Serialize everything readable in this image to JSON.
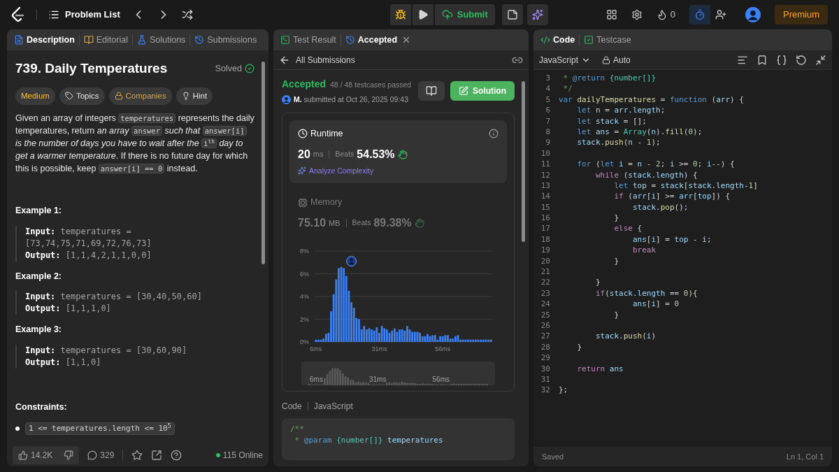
{
  "topbar": {
    "title": "Problem List",
    "submit": "Submit",
    "streak": "0",
    "premium": "Premium"
  },
  "left": {
    "tabs": [
      {
        "label": "Description",
        "selected": true
      },
      {
        "label": "Editorial",
        "selected": false
      },
      {
        "label": "Solutions",
        "selected": false
      },
      {
        "label": "Submissions",
        "selected": false
      }
    ],
    "title": "739. Daily Temperatures",
    "status": "Solved",
    "tags": [
      {
        "kind": "difficulty",
        "label": "Medium"
      },
      {
        "kind": "topics",
        "label": "Topics"
      },
      {
        "kind": "companies",
        "label": "Companies"
      },
      {
        "kind": "hint",
        "label": "Hint"
      }
    ],
    "description": [
      {
        "kind": "text",
        "text": "Given an array of integers "
      },
      {
        "kind": "code",
        "text": "temperatures"
      },
      {
        "kind": "text",
        "text": " represents the daily temperatures, return "
      },
      {
        "kind": "em",
        "text": "an array "
      },
      {
        "kind": "code",
        "text": "answer"
      },
      {
        "kind": "em",
        "text": " such that "
      },
      {
        "kind": "code",
        "text": "answer[i]"
      },
      {
        "kind": "em",
        "text": " is the number of days you have to wait after the "
      },
      {
        "kind": "code",
        "text": "i$^{th}$"
      },
      {
        "kind": "em",
        "text": " day to get a warmer temperature"
      },
      {
        "kind": "text",
        "text": ". If there is no future day for which this is possible, keep "
      },
      {
        "kind": "code",
        "text": "answer[i] == 0"
      },
      {
        "kind": "text",
        "text": " instead."
      }
    ],
    "examples": [
      {
        "title": "Example 1:",
        "input_label": "Input:",
        "input": "temperatures = [73,74,75,71,69,72,76,73]",
        "output_label": "Output:",
        "output": "[1,1,4,2,1,1,0,0]"
      },
      {
        "title": "Example 2:",
        "input_label": "Input:",
        "input": "temperatures = [30,40,50,60]",
        "output_label": "Output:",
        "output": "[1,1,1,0]"
      },
      {
        "title": "Example 3:",
        "input_label": "Input:",
        "input": "temperatures = [30,60,90]",
        "output_label": "Output:",
        "output": "[1,1,0]"
      }
    ],
    "constraints_title": "Constraints:",
    "constraints": [
      "1 <= temperatures.length <= 10$^{5}$"
    ],
    "footer": {
      "likes": "14.2K",
      "comments": "329",
      "online": "115 Online"
    }
  },
  "middle": {
    "tabs": [
      {
        "label": "Test Result",
        "selected": false,
        "closable": false
      },
      {
        "label": "Accepted",
        "selected": true,
        "closable": true
      }
    ],
    "back": "All Submissions",
    "status": "Accepted",
    "passed": "48 / 48 testcases passed",
    "user": "M.",
    "submitted": "submitted at Oct 26, 2025 09:43",
    "solution": "Solution",
    "metrics": [
      {
        "kind": "runtime",
        "title": "Runtime",
        "value": "20",
        "unit": "ms",
        "beats_label": "Beats",
        "beats": "54.53%",
        "action": "Analyze Complexity",
        "selected": true
      },
      {
        "kind": "memory",
        "title": "Memory",
        "value": "75.10",
        "unit": "MB",
        "beats_label": "Beats",
        "beats": "89.38%",
        "selected": false
      }
    ],
    "chart_data": {
      "type": "bar",
      "x": [
        6,
        7,
        8,
        9,
        10,
        11,
        12,
        13,
        14,
        15,
        16,
        17,
        18,
        19,
        20,
        21,
        22,
        23,
        24,
        25,
        26,
        27,
        28,
        29,
        30,
        31,
        32,
        33,
        34,
        35,
        36,
        37,
        38,
        39,
        40,
        41,
        42,
        43,
        44,
        45,
        46,
        47,
        48,
        49,
        50,
        51,
        52,
        53,
        54,
        55,
        56,
        57,
        58,
        59,
        60,
        61,
        62,
        63,
        64,
        65,
        66,
        67,
        68,
        69,
        70,
        71,
        72,
        73,
        74,
        75
      ],
      "values": [
        0.2,
        0.2,
        0.2,
        0.3,
        0.7,
        0.8,
        2.7,
        4.2,
        5.5,
        6.5,
        6.6,
        6.5,
        5.8,
        4.5,
        3.5,
        3.0,
        2.1,
        2.0,
        1.1,
        1.4,
        1.1,
        1.2,
        1.1,
        1.0,
        1.3,
        0.8,
        1.4,
        1.2,
        1.1,
        0.8,
        1.0,
        1.2,
        0.9,
        1.1,
        1.1,
        1.0,
        1.4,
        1.1,
        0.9,
        0.9,
        0.9,
        0.8,
        0.5,
        0.5,
        0.7,
        0.5,
        0.6,
        0.6,
        0.2,
        0.5,
        0.5,
        0.6,
        0.6,
        0.3,
        0.3,
        0.5,
        0.6,
        0.2,
        0.2,
        0.2,
        0.2,
        0.2,
        0.2,
        0.2,
        0.2,
        0.2,
        0.2,
        0.2,
        0.2,
        0.2
      ],
      "xlim": [
        5.5,
        75.5
      ],
      "ylim": [
        0,
        8
      ],
      "grid": true,
      "yticks": [
        {
          "value": 0,
          "label": "0%"
        },
        {
          "value": 2,
          "label": "2%"
        },
        {
          "value": 4,
          "label": "4%"
        },
        {
          "value": 6,
          "label": "6%"
        },
        {
          "value": 8,
          "label": "8%"
        }
      ],
      "xticks": [
        {
          "value": 6,
          "label": "6ms"
        },
        {
          "value": 31,
          "label": "31ms"
        },
        {
          "value": 56,
          "label": "56ms"
        }
      ]
    },
    "overview_labels": [
      "6ms",
      "31ms",
      "56ms"
    ],
    "code_label": "Code",
    "language": "JavaScript",
    "code": [
      [
        {
          "kind": "cm",
          "text": "/**"
        }
      ],
      [
        {
          "kind": "cm",
          "text": " *"
        },
        {
          "kind": "tag",
          "text": " @param"
        },
        {
          "kind": "type",
          "text": " {number[]}"
        },
        {
          "kind": "id",
          "text": " temperatures"
        }
      ]
    ]
  },
  "right": {
    "tabs": [
      {
        "label": "Code",
        "selected": true
      },
      {
        "label": "Testcase",
        "selected": false
      }
    ],
    "language": "JavaScript",
    "mode": "Auto",
    "lines": [
      {
        "n": "3",
        "t": [
          {
            "kind": "cm",
            "text": " *"
          },
          {
            "kind": "tag",
            "text": " @return"
          },
          {
            "kind": "type",
            "text": " {number[]}"
          }
        ]
      },
      {
        "n": "4",
        "t": [
          {
            "kind": "cm",
            "text": " */"
          }
        ]
      },
      {
        "n": "5",
        "t": [
          {
            "kind": "kw",
            "text": "var"
          },
          {
            "kind": "fn",
            "text": " dailyTemperatures"
          },
          {
            "kind": "p",
            "text": " = "
          },
          {
            "kind": "kw",
            "text": "function"
          },
          {
            "kind": "p",
            "text": " ("
          },
          {
            "kind": "id",
            "text": "arr"
          },
          {
            "kind": "p",
            "text": ") {"
          }
        ]
      },
      {
        "n": "6",
        "t": [
          {
            "kind": "kw",
            "text": "    let"
          },
          {
            "kind": "id",
            "text": " n"
          },
          {
            "kind": "p",
            "text": " = "
          },
          {
            "kind": "id",
            "text": "arr"
          },
          {
            "kind": "p",
            "text": "."
          },
          {
            "kind": "id",
            "text": "length"
          },
          {
            "kind": "p",
            "text": ";"
          }
        ]
      },
      {
        "n": "7",
        "t": [
          {
            "kind": "kw",
            "text": "    let"
          },
          {
            "kind": "id",
            "text": " stack"
          },
          {
            "kind": "p",
            "text": " = [];"
          }
        ]
      },
      {
        "n": "8",
        "t": [
          {
            "kind": "kw",
            "text": "    let"
          },
          {
            "kind": "id",
            "text": " ans"
          },
          {
            "kind": "p",
            "text": " = "
          },
          {
            "kind": "cls",
            "text": "Array"
          },
          {
            "kind": "p",
            "text": "("
          },
          {
            "kind": "id",
            "text": "n"
          },
          {
            "kind": "p",
            "text": ")."
          },
          {
            "kind": "fn",
            "text": "fill"
          },
          {
            "kind": "p",
            "text": "("
          },
          {
            "kind": "num",
            "text": "0"
          },
          {
            "kind": "p",
            "text": ");"
          }
        ]
      },
      {
        "n": "9",
        "t": [
          {
            "kind": "id",
            "text": "    stack"
          },
          {
            "kind": "p",
            "text": "."
          },
          {
            "kind": "fn",
            "text": "push"
          },
          {
            "kind": "p",
            "text": "("
          },
          {
            "kind": "id",
            "text": "n"
          },
          {
            "kind": "p",
            "text": " - "
          },
          {
            "kind": "num",
            "text": "1"
          },
          {
            "kind": "p",
            "text": ");"
          }
        ]
      },
      {
        "n": "10"
      },
      {
        "n": "11",
        "t": [
          {
            "kind": "kw",
            "text": "    for"
          },
          {
            "kind": "p",
            "text": " ("
          },
          {
            "kind": "kw",
            "text": "let"
          },
          {
            "kind": "id",
            "text": " i"
          },
          {
            "kind": "p",
            "text": " = "
          },
          {
            "kind": "id",
            "text": "n"
          },
          {
            "kind": "p",
            "text": " - "
          },
          {
            "kind": "num",
            "text": "2"
          },
          {
            "kind": "p",
            "text": "; "
          },
          {
            "kind": "id",
            "text": "i"
          },
          {
            "kind": "p",
            "text": " >= "
          },
          {
            "kind": "num",
            "text": "0"
          },
          {
            "kind": "p",
            "text": "; "
          },
          {
            "kind": "id",
            "text": "i"
          },
          {
            "kind": "p",
            "text": "--) {"
          }
        ]
      },
      {
        "n": "12",
        "t": [
          {
            "kind": "ctl",
            "text": "        while"
          },
          {
            "kind": "p",
            "text": " ("
          },
          {
            "kind": "id",
            "text": "stack"
          },
          {
            "kind": "p",
            "text": "."
          },
          {
            "kind": "id",
            "text": "length"
          },
          {
            "kind": "p",
            "text": ") {"
          }
        ]
      },
      {
        "n": "13",
        "t": [
          {
            "kind": "kw",
            "text": "            let"
          },
          {
            "kind": "id",
            "text": " top"
          },
          {
            "kind": "p",
            "text": " = "
          },
          {
            "kind": "id",
            "text": "stack"
          },
          {
            "kind": "p",
            "text": "["
          },
          {
            "kind": "id",
            "text": "stack"
          },
          {
            "kind": "p",
            "text": "."
          },
          {
            "kind": "id",
            "text": "length"
          },
          {
            "kind": "p",
            "text": "-"
          },
          {
            "kind": "num",
            "text": "1"
          },
          {
            "kind": "p",
            "text": "]"
          }
        ]
      },
      {
        "n": "14",
        "t": [
          {
            "kind": "ctl",
            "text": "            if"
          },
          {
            "kind": "p",
            "text": " ("
          },
          {
            "kind": "id",
            "text": "arr"
          },
          {
            "kind": "p",
            "text": "["
          },
          {
            "kind": "id",
            "text": "i"
          },
          {
            "kind": "p",
            "text": "] >= "
          },
          {
            "kind": "id",
            "text": "arr"
          },
          {
            "kind": "p",
            "text": "["
          },
          {
            "kind": "id",
            "text": "top"
          },
          {
            "kind": "p",
            "text": "]) {"
          }
        ]
      },
      {
        "n": "15",
        "t": [
          {
            "kind": "id",
            "text": "                stack"
          },
          {
            "kind": "p",
            "text": "."
          },
          {
            "kind": "fn",
            "text": "pop"
          },
          {
            "kind": "p",
            "text": "();"
          }
        ]
      },
      {
        "n": "16",
        "t": [
          {
            "kind": "p",
            "text": "            }"
          }
        ]
      },
      {
        "n": "17",
        "t": [
          {
            "kind": "ctl",
            "text": "            else"
          },
          {
            "kind": "p",
            "text": " {"
          }
        ]
      },
      {
        "n": "18",
        "t": [
          {
            "kind": "id",
            "text": "                ans"
          },
          {
            "kind": "p",
            "text": "["
          },
          {
            "kind": "id",
            "text": "i"
          },
          {
            "kind": "p",
            "text": "] = "
          },
          {
            "kind": "id",
            "text": "top"
          },
          {
            "kind": "p",
            "text": " - "
          },
          {
            "kind": "id",
            "text": "i"
          },
          {
            "kind": "p",
            "text": ";"
          }
        ]
      },
      {
        "n": "19",
        "t": [
          {
            "kind": "ctl",
            "text": "                break"
          }
        ]
      },
      {
        "n": "20",
        "t": [
          {
            "kind": "p",
            "text": "            }"
          }
        ]
      },
      {
        "n": "21"
      },
      {
        "n": "22",
        "t": [
          {
            "kind": "p",
            "text": "        }"
          }
        ]
      },
      {
        "n": "23",
        "t": [
          {
            "kind": "ctl",
            "text": "        if"
          },
          {
            "kind": "p",
            "text": "("
          },
          {
            "kind": "id",
            "text": "stack"
          },
          {
            "kind": "p",
            "text": "."
          },
          {
            "kind": "id",
            "text": "length"
          },
          {
            "kind": "p",
            "text": " == "
          },
          {
            "kind": "num",
            "text": "0"
          },
          {
            "kind": "p",
            "text": "){"
          }
        ]
      },
      {
        "n": "24",
        "t": [
          {
            "kind": "id",
            "text": "                ans"
          },
          {
            "kind": "p",
            "text": "["
          },
          {
            "kind": "id",
            "text": "i"
          },
          {
            "kind": "p",
            "text": "] = "
          },
          {
            "kind": "num",
            "text": "0"
          }
        ]
      },
      {
        "n": "25",
        "t": [
          {
            "kind": "p",
            "text": "            }"
          }
        ]
      },
      {
        "n": "26"
      },
      {
        "n": "27",
        "t": [
          {
            "kind": "id",
            "text": "        stack"
          },
          {
            "kind": "p",
            "text": "."
          },
          {
            "kind": "fn",
            "text": "push"
          },
          {
            "kind": "p",
            "text": "("
          },
          {
            "kind": "id",
            "text": "i"
          },
          {
            "kind": "p",
            "text": ")"
          }
        ]
      },
      {
        "n": "28",
        "t": [
          {
            "kind": "p",
            "text": "    }"
          }
        ]
      },
      {
        "n": "29"
      },
      {
        "n": "30",
        "t": [
          {
            "kind": "ctl",
            "text": "    return"
          },
          {
            "kind": "id",
            "text": " ans"
          }
        ]
      },
      {
        "n": "31"
      },
      {
        "n": "32",
        "t": [
          {
            "kind": "p",
            "text": "};"
          }
        ]
      }
    ],
    "status": "Saved",
    "cursor": "Ln 1, Col 1"
  }
}
